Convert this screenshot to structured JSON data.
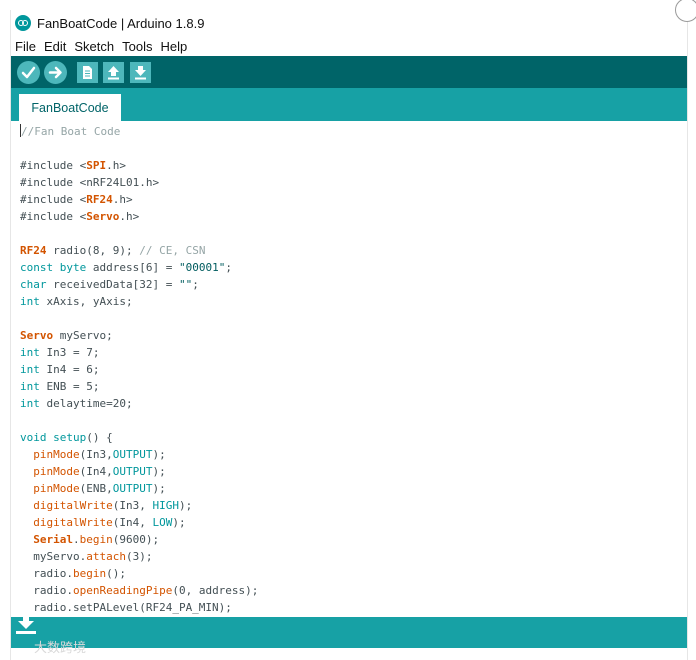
{
  "window": {
    "title": "FanBoatCode | Arduino 1.8.9"
  },
  "menu": [
    "File",
    "Edit",
    "Sketch",
    "Tools",
    "Help"
  ],
  "toolbar": {
    "buttons": [
      {
        "name": "verify",
        "icon": "check-icon"
      },
      {
        "name": "upload",
        "icon": "arrow-right-icon"
      },
      {
        "name": "new",
        "icon": "new-file-icon"
      },
      {
        "name": "open",
        "icon": "arrow-up-icon"
      },
      {
        "name": "save",
        "icon": "arrow-down-icon"
      }
    ]
  },
  "tabs": [
    {
      "label": "FanBoatCode"
    }
  ],
  "code_lines": [
    [
      {
        "t": "//Fan Boat Code",
        "c": "cm"
      }
    ],
    [],
    [
      {
        "t": "#include <"
      },
      {
        "t": "SPI",
        "c": "cls"
      },
      {
        "t": ".h>"
      }
    ],
    [
      {
        "t": "#include <nRF24L01.h>"
      }
    ],
    [
      {
        "t": "#include <"
      },
      {
        "t": "RF24",
        "c": "cls"
      },
      {
        "t": ".h>"
      }
    ],
    [
      {
        "t": "#include <"
      },
      {
        "t": "Servo",
        "c": "cls"
      },
      {
        "t": ".h>"
      }
    ],
    [],
    [
      {
        "t": "RF24",
        "c": "cls"
      },
      {
        "t": " radio(8, 9); "
      },
      {
        "t": "// CE, CSN",
        "c": "cm"
      }
    ],
    [
      {
        "t": "const",
        "c": "kw"
      },
      {
        "t": " "
      },
      {
        "t": "byte",
        "c": "kw"
      },
      {
        "t": " address[6] = "
      },
      {
        "t": "\"00001\"",
        "c": "str"
      },
      {
        "t": ";"
      }
    ],
    [
      {
        "t": "char",
        "c": "kw"
      },
      {
        "t": " receivedData[32] = "
      },
      {
        "t": "\"\"",
        "c": "str"
      },
      {
        "t": ";"
      }
    ],
    [
      {
        "t": "int",
        "c": "kw"
      },
      {
        "t": " xAxis, yAxis;"
      }
    ],
    [],
    [
      {
        "t": "Servo",
        "c": "cls"
      },
      {
        "t": " myServo;"
      }
    ],
    [
      {
        "t": "int",
        "c": "kw"
      },
      {
        "t": " In3 = 7;"
      }
    ],
    [
      {
        "t": "int",
        "c": "kw"
      },
      {
        "t": " In4 = 6;"
      }
    ],
    [
      {
        "t": "int",
        "c": "kw"
      },
      {
        "t": " ENB = 5;"
      }
    ],
    [
      {
        "t": "int",
        "c": "kw"
      },
      {
        "t": " delaytime=20;"
      }
    ],
    [],
    [
      {
        "t": "void",
        "c": "kw"
      },
      {
        "t": " "
      },
      {
        "t": "setup",
        "c": "kw"
      },
      {
        "t": "() {"
      }
    ],
    [
      {
        "t": "  "
      },
      {
        "t": "pinMode",
        "c": "fn"
      },
      {
        "t": "(In3,"
      },
      {
        "t": "OUTPUT",
        "c": "kw"
      },
      {
        "t": ");"
      }
    ],
    [
      {
        "t": "  "
      },
      {
        "t": "pinMode",
        "c": "fn"
      },
      {
        "t": "(In4,"
      },
      {
        "t": "OUTPUT",
        "c": "kw"
      },
      {
        "t": ");"
      }
    ],
    [
      {
        "t": "  "
      },
      {
        "t": "pinMode",
        "c": "fn"
      },
      {
        "t": "(ENB,"
      },
      {
        "t": "OUTPUT",
        "c": "kw"
      },
      {
        "t": ");"
      }
    ],
    [
      {
        "t": "  "
      },
      {
        "t": "digitalWrite",
        "c": "fn"
      },
      {
        "t": "(In3, "
      },
      {
        "t": "HIGH",
        "c": "kw"
      },
      {
        "t": ");"
      }
    ],
    [
      {
        "t": "  "
      },
      {
        "t": "digitalWrite",
        "c": "fn"
      },
      {
        "t": "(In4, "
      },
      {
        "t": "LOW",
        "c": "kw"
      },
      {
        "t": ");"
      }
    ],
    [
      {
        "t": "  "
      },
      {
        "t": "Serial",
        "c": "cls"
      },
      {
        "t": "."
      },
      {
        "t": "begin",
        "c": "fn"
      },
      {
        "t": "(9600);"
      }
    ],
    [
      {
        "t": "  myServo."
      },
      {
        "t": "attach",
        "c": "fn"
      },
      {
        "t": "(3);"
      }
    ],
    [
      {
        "t": "  radio."
      },
      {
        "t": "begin",
        "c": "fn"
      },
      {
        "t": "();"
      }
    ],
    [
      {
        "t": "  radio."
      },
      {
        "t": "openReadingPipe",
        "c": "fn"
      },
      {
        "t": "(0, address);"
      }
    ],
    [
      {
        "t": "  radio.setPALevel(RF24_PA_MIN);"
      }
    ]
  ],
  "watermark": {
    "text": "大数跨境",
    "icon": "download-icon"
  }
}
